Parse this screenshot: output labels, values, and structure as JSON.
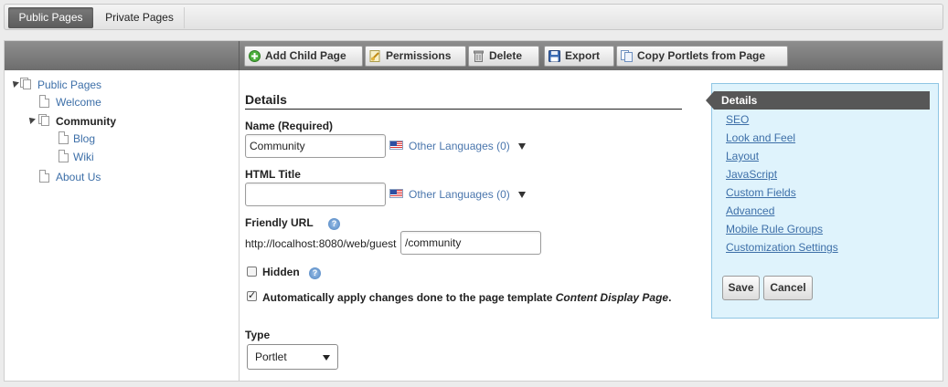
{
  "top_tabs": {
    "public": "Public Pages",
    "private": "Private Pages"
  },
  "toolbar": {
    "add_child": "Add Child Page",
    "permissions": "Permissions",
    "delete": "Delete",
    "export": "Export",
    "copy_portlets": "Copy Portlets from Page"
  },
  "tree": {
    "root": "Public Pages",
    "items": [
      "Welcome",
      "Community",
      "Blog",
      "Wiki",
      "About Us"
    ]
  },
  "form": {
    "section_title": "Details",
    "name_label": "Name (Required)",
    "name_value": "Community",
    "other_languages": "Other Languages (0)",
    "html_title_label": "HTML Title",
    "html_title_value": "",
    "friendly_url_label": "Friendly URL",
    "url_prefix": "http://localhost:8080/web/guest",
    "friendly_url_value": "/community",
    "hidden_label": "Hidden",
    "auto_apply_label": "Automatically apply changes done to the page template",
    "auto_apply_template": "Content Display Page",
    "auto_apply_period": ".",
    "type_label": "Type",
    "type_value": "Portlet",
    "hidden_checked": false,
    "auto_apply_checked": true
  },
  "nav": {
    "active": "Details",
    "links": [
      "SEO",
      "Look and Feel",
      "Layout",
      "JavaScript",
      "Custom Fields",
      "Advanced",
      "Mobile Rule Groups",
      "Customization Settings"
    ],
    "save": "Save",
    "cancel": "Cancel"
  },
  "colors": {
    "link": "#3d6fa8",
    "nav_bg": "#dff3fc",
    "toolbar": "#7a7a7a"
  },
  "icons": {
    "add": "plus-circle-icon",
    "permissions": "key-icon",
    "delete": "trash-icon",
    "export": "floppy-icon",
    "copy": "copy-pages-icon",
    "help": "help-icon",
    "flag": "us-flag-icon"
  }
}
